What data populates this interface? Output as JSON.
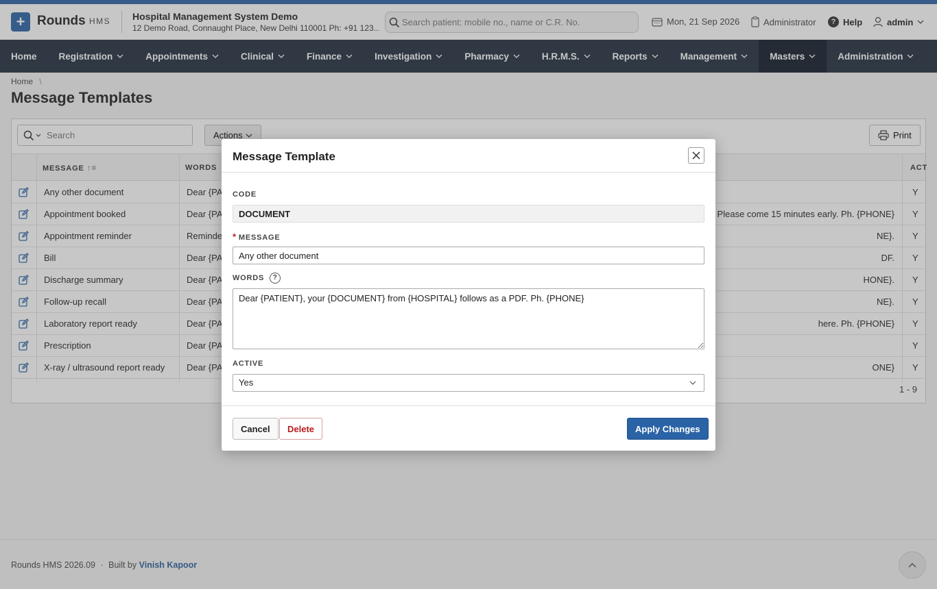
{
  "header": {
    "logo_glyph": "+",
    "brand": "Rounds",
    "brand_sub": "HMS",
    "hospital_name": "Hospital Management System Demo",
    "hospital_address": "12 Demo Road, Connaught Place, New Delhi 110001 Ph: +91 123...",
    "search_placeholder": "Search patient: mobile no., name or C.R. No.",
    "date": "Mon, 21 Sep 2026",
    "role": "Administrator",
    "help": "Help",
    "help_glyph": "?",
    "user": "admin"
  },
  "nav": {
    "items": [
      "Home",
      "Registration",
      "Appointments",
      "Clinical",
      "Finance",
      "Investigation",
      "Pharmacy",
      "H.R.M.S.",
      "Reports",
      "Management",
      "Masters",
      "Administration"
    ],
    "active": "Masters"
  },
  "breadcrumb": {
    "home": "Home",
    "sep": "\\"
  },
  "page": {
    "title": "Message Templates"
  },
  "toolbar": {
    "search_placeholder": "Search",
    "actions": "Actions",
    "print": "Print"
  },
  "table": {
    "columns": {
      "message": "MESSAGE",
      "words": "WORDS",
      "active": "ACT"
    },
    "rows": [
      {
        "message": "Any other document",
        "words_start": "Dear {PA",
        "words_end": "",
        "active": "Y"
      },
      {
        "message": "Appointment booked",
        "words_start": "Dear {PA",
        "words_end": "Please come 15 minutes early. Ph. {PHONE}",
        "active": "Y"
      },
      {
        "message": "Appointment reminder",
        "words_start": "Reminde",
        "words_end": "NE}.",
        "active": "Y"
      },
      {
        "message": "Bill",
        "words_start": "Dear {PA",
        "words_end": "DF.",
        "active": "Y"
      },
      {
        "message": "Discharge summary",
        "words_start": "Dear {PA",
        "words_end": "HONE}.",
        "active": "Y"
      },
      {
        "message": "Follow-up recall",
        "words_start": "Dear {PA",
        "words_end": "NE}.",
        "active": "Y"
      },
      {
        "message": "Laboratory report ready",
        "words_start": "Dear {PA",
        "words_end": "here. Ph. {PHONE}",
        "active": "Y"
      },
      {
        "message": "Prescription",
        "words_start": "Dear {PA",
        "words_end": "",
        "active": "Y"
      },
      {
        "message": "X-ray / ultrasound report ready",
        "words_start": "Dear {PA",
        "words_end": "ONE}",
        "active": "Y"
      }
    ],
    "pagination": "1 - 9"
  },
  "dialog": {
    "title": "Message Template",
    "code_label": "CODE",
    "code_value": "DOCUMENT",
    "message_label": "MESSAGE",
    "required_mark": "*",
    "message_value": "Any other document",
    "words_label": "WORDS",
    "words_value": "Dear {PATIENT}, your {DOCUMENT} from {HOSPITAL} follows as a PDF. Ph. {PHONE}",
    "active_label": "ACTIVE",
    "active_value": "Yes",
    "cancel": "Cancel",
    "delete": "Delete",
    "apply": "Apply Changes"
  },
  "footer": {
    "version": "Rounds HMS 2026.09",
    "dot": "·",
    "built_by": "Built by",
    "author": "Vinish Kapoor"
  },
  "colors": {
    "brand": "#2a64a6",
    "nav_bg": "#1f2d3d",
    "delete": "#b71c1c"
  }
}
